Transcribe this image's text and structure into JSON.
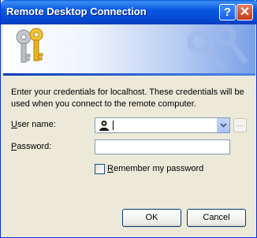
{
  "window": {
    "title": "Remote Desktop Connection",
    "help_label": "?",
    "close_label": "✕"
  },
  "content": {
    "message": "Enter your credentials for localhost. These credentials will be used when you connect to the remote computer.",
    "username": {
      "label_mnemonic": "U",
      "label_rest": "ser name:",
      "value": ""
    },
    "password": {
      "label_mnemonic": "P",
      "label_rest": "assword:",
      "value": ""
    },
    "remember": {
      "label_mnemonic": "R",
      "label_rest": "emember my password",
      "checked": false
    },
    "browse_label": "...",
    "ok_label": "OK",
    "cancel_mnemonic": "",
    "cancel_label": "Cancel"
  },
  "colors": {
    "title_bar": "#0a58e0",
    "dialog_bg": "#ece9d8",
    "field_border": "#7f9db9",
    "button_border": "#003c74"
  },
  "icons": [
    "help-icon",
    "close-icon",
    "keys-icon",
    "user-icon",
    "dropdown-arrow-icon"
  ]
}
